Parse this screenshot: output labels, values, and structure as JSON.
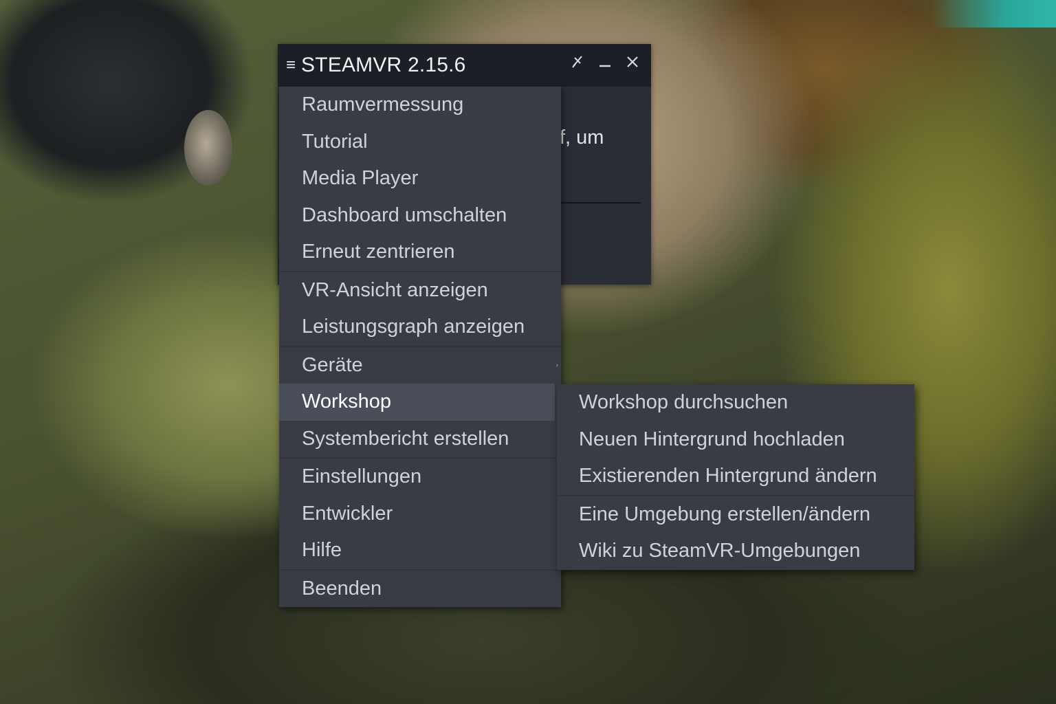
{
  "window": {
    "title": "STEAMVR 2.15.6",
    "menu_icon": "hamburger-icon",
    "partial_text": "f, um"
  },
  "menu": {
    "items": [
      {
        "label": "Raumvermessung"
      },
      {
        "label": "Tutorial"
      },
      {
        "label": "Media Player"
      },
      {
        "label": "Dashboard umschalten"
      },
      {
        "label": "Erneut zentrieren"
      },
      {
        "label": "VR-Ansicht anzeigen"
      },
      {
        "label": "Leistungsgraph anzeigen"
      },
      {
        "label": "Geräte"
      },
      {
        "label": "Workshop"
      },
      {
        "label": "Systembericht erstellen"
      },
      {
        "label": "Einstellungen"
      },
      {
        "label": "Entwickler"
      },
      {
        "label": "Hilfe"
      },
      {
        "label": "Beenden"
      }
    ]
  },
  "submenu": {
    "items": [
      {
        "label": "Workshop durchsuchen"
      },
      {
        "label": "Neuen Hintergrund hochladen"
      },
      {
        "label": "Existierenden Hintergrund ändern"
      },
      {
        "label": "Eine Umgebung erstellen/ändern"
      },
      {
        "label": "Wiki zu SteamVR-Umgebungen"
      }
    ]
  },
  "colors": {
    "titlebar": "#1c1f26",
    "menu_bg": "#393c45",
    "menu_active": "#4a4e58",
    "text": "#cfd3d9"
  }
}
